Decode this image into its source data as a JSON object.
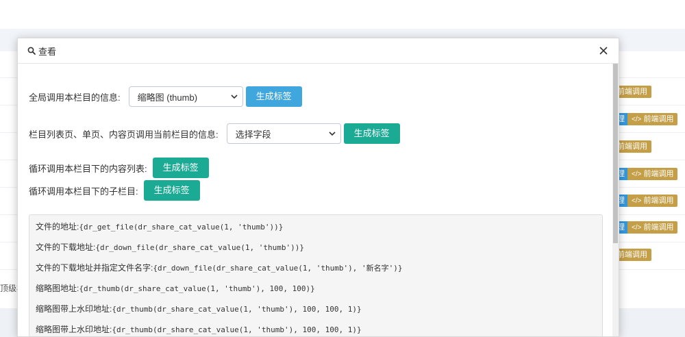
{
  "background": {
    "left_text": "顶级栏",
    "tags": {
      "frontend_call": "前端调用",
      "blue_label": "理",
      "code_symbol": "</>"
    }
  },
  "modal": {
    "title": "查看",
    "rows": {
      "global": {
        "label": "全局调用本栏目的信息:",
        "select_value": "缩略图 (thumb)",
        "button": "生成标签"
      },
      "current": {
        "label": "栏目列表页、单页、内容页调用当前栏目的信息:",
        "select_value": "选择字段",
        "button": "生成标签"
      },
      "content_list": {
        "label": "循环调用本栏目下的内容列表:",
        "button": "生成标签"
      },
      "sub_cats": {
        "label": "循环调用本栏目下的子栏目:",
        "button": "生成标签"
      }
    },
    "code_lines": [
      {
        "label": "文件的地址:",
        "code": "{dr_get_file(dr_share_cat_value(1, 'thumb'))}"
      },
      {
        "label": "文件的下载地址:",
        "code": "{dr_down_file(dr_share_cat_value(1, 'thumb'))}"
      },
      {
        "label": "文件的下载地址并指定文件名字:",
        "code": "{dr_down_file(dr_share_cat_value(1, 'thumb'), '新名字')}"
      },
      {
        "label": "缩略图地址:",
        "code": "{dr_thumb(dr_share_cat_value(1, 'thumb'), 100, 100)}"
      },
      {
        "label": "缩略图带上水印地址:",
        "code": "{dr_thumb(dr_share_cat_value(1, 'thumb'), 100, 100, 1)}"
      },
      {
        "label": "缩略图带上水印地址:",
        "code": "{dr_thumb(dr_share_cat_value(1, 'thumb'), 100, 100, 1)}"
      }
    ]
  },
  "colors": {
    "btn_blue": "#3fa6de",
    "btn_green": "#1bab94",
    "tag_gold": "#c49f47",
    "tag_blue": "#3598dc"
  }
}
